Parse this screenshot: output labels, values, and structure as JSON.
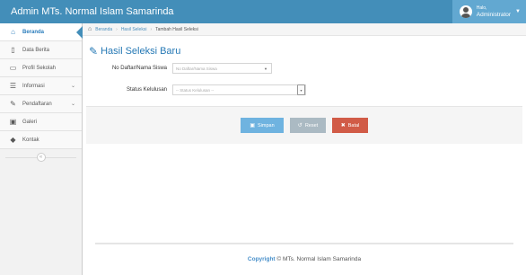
{
  "app": {
    "title": "Admin MTs. Normal Islam Samarinda"
  },
  "user": {
    "welcome": "Halo,",
    "name": "Administrator",
    "icon": "user-avatar-icon"
  },
  "sidebar": {
    "items": [
      {
        "label": "Beranda",
        "icon": "home-icon",
        "active": true
      },
      {
        "label": "Data Berita",
        "icon": "document-icon"
      },
      {
        "label": "Profil Sekolah",
        "icon": "monitor-icon"
      },
      {
        "label": "Informasi",
        "icon": "list-icon",
        "has_submenu": true
      },
      {
        "label": "Pendaftaran",
        "icon": "edit-icon",
        "has_submenu": true
      },
      {
        "label": "Galeri",
        "icon": "picture-icon"
      },
      {
        "label": "Kontak",
        "icon": "tag-icon"
      }
    ],
    "collapse_icon": "double-chevron-left-icon"
  },
  "breadcrumb": {
    "items": [
      "Beranda",
      "Hasil Seleksi",
      "Tambah Hasil Seleksi"
    ]
  },
  "page": {
    "title": "Hasil Seleksi Baru",
    "title_icon": "edit-icon"
  },
  "form": {
    "fields": [
      {
        "label": "No Daftar/Nama Siswa",
        "placeholder": "No Daftar/Nama Siswa"
      },
      {
        "label": "Status Kelulusan",
        "placeholder": "-- Status Kelulusan --"
      }
    ],
    "buttons": {
      "save": "Simpan",
      "reset": "Reset",
      "cancel": "Batal"
    }
  },
  "footer": {
    "copyright": "Copyright",
    "text": "© MTs. Normal Islam Samarinda"
  },
  "colors": {
    "navbar": "#438eb9",
    "title": "#2679b5",
    "save": "#6fb3e0",
    "reset": "#abbac3",
    "cancel": "#d15b47"
  }
}
